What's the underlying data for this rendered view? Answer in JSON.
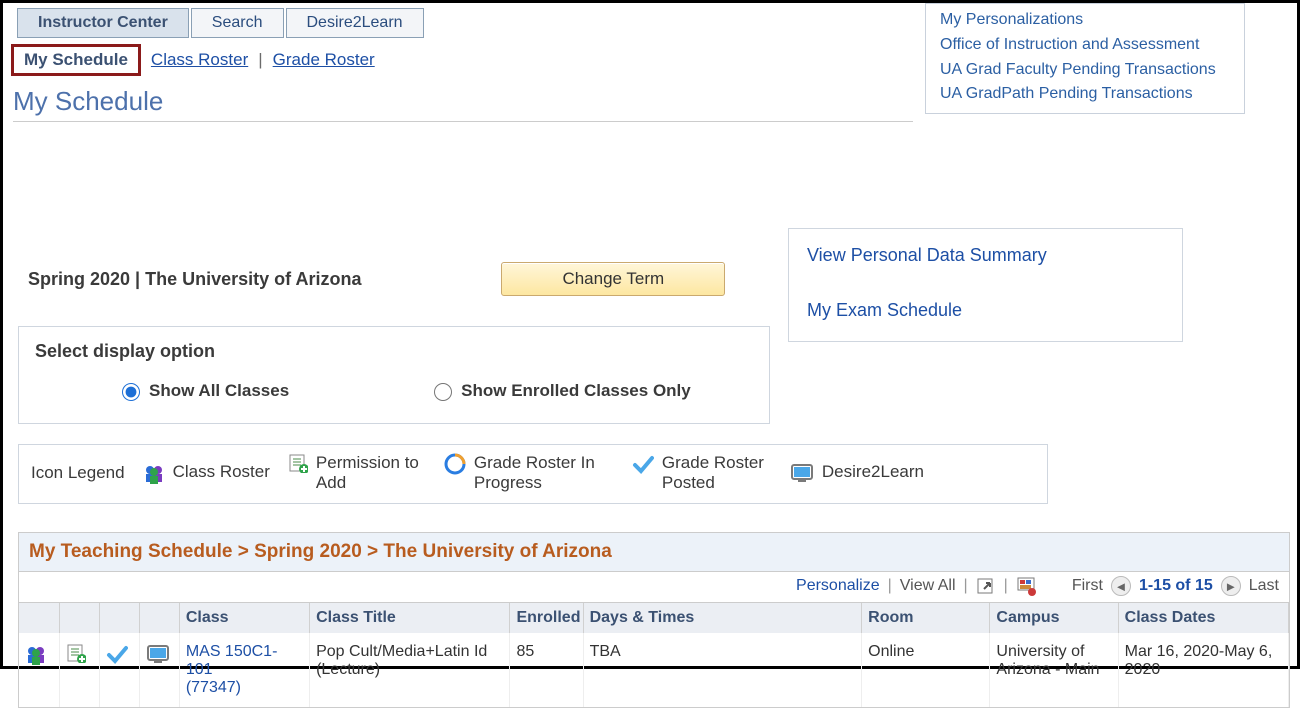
{
  "tabs": {
    "instructor_center": "Instructor Center",
    "search": "Search",
    "d2l": "Desire2Learn"
  },
  "side_links": [
    "My Personalizations",
    "Office of Instruction and Assessment",
    "UA Grad Faculty Pending Transactions",
    "UA GradPath Pending Transactions"
  ],
  "subtabs": {
    "my_schedule": "My Schedule",
    "class_roster": "Class Roster",
    "grade_roster": "Grade Roster"
  },
  "page_title": "My Schedule",
  "term": {
    "label": "Spring 2020 | The University of Arizona",
    "change_btn": "Change Term"
  },
  "right_panel": {
    "personal_data": "View Personal Data Summary",
    "exam_schedule": "My Exam Schedule"
  },
  "display_options": {
    "title": "Select display option",
    "show_all": "Show All Classes",
    "show_enrolled": "Show Enrolled Classes Only",
    "selected": "show_all"
  },
  "legend": {
    "title": "Icon Legend",
    "class_roster": "Class Roster",
    "permission_add": "Permission to Add",
    "grade_progress": "Grade Roster In Progress",
    "grade_posted": "Grade Roster Posted",
    "d2l": "Desire2Learn"
  },
  "teaching_table": {
    "title": "My Teaching Schedule > Spring 2020 > The University of Arizona",
    "toolbar": {
      "personalize": "Personalize",
      "view_all": "View All",
      "first": "First",
      "range": "1-15 of 15",
      "last": "Last"
    },
    "headers": {
      "class": "Class",
      "class_title": "Class Title",
      "enrolled": "Enrolled",
      "days_times": "Days & Times",
      "room": "Room",
      "campus": "Campus",
      "class_dates": "Class Dates"
    },
    "rows": [
      {
        "class_line1": "MAS 150C1-",
        "class_line2": "101",
        "class_line3": "(77347)",
        "title": "Pop Cult/Media+Latin Id (Lecture)",
        "enrolled": "85",
        "days": "TBA",
        "room": "Online",
        "campus": "University of Arizona - Main",
        "dates": "Mar 16, 2020-May 6, 2020"
      }
    ]
  }
}
